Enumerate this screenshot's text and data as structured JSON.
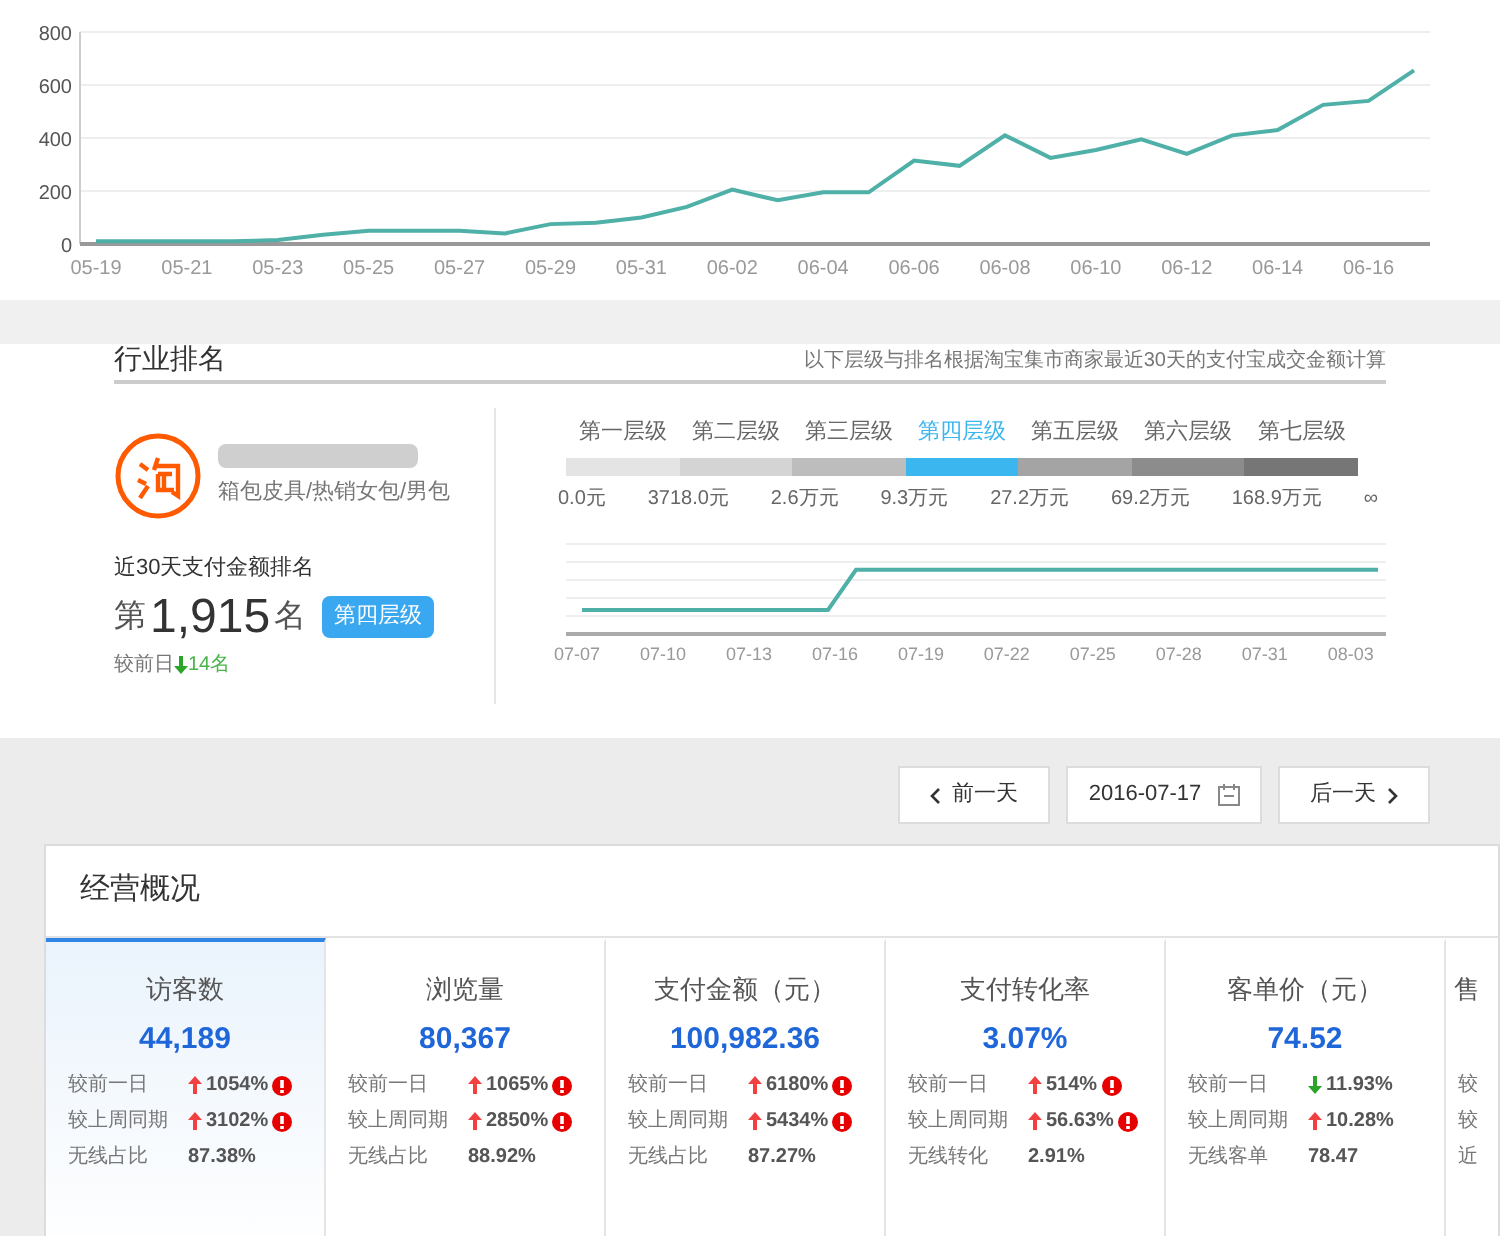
{
  "trend_chart": {
    "chart_data": {
      "type": "line",
      "grid": true,
      "categories": [
        "05-19",
        null,
        "05-21",
        null,
        "05-23",
        null,
        "05-25",
        null,
        "05-27",
        null,
        "05-29",
        null,
        "05-31",
        null,
        "06-02",
        null,
        "06-04",
        null,
        "06-06",
        null,
        "06-08",
        null,
        "06-10",
        null,
        "06-12",
        null,
        "06-14",
        null,
        "06-16",
        null
      ],
      "series": [
        {
          "color": "#4fb0a8",
          "values": [
            10,
            10,
            10,
            10,
            15,
            35,
            50,
            50,
            50,
            40,
            75,
            80,
            100,
            140,
            205,
            165,
            195,
            195,
            315,
            295,
            410,
            325,
            355,
            395,
            340,
            410,
            430,
            525,
            540,
            655
          ]
        }
      ],
      "ylim": [
        0,
        800
      ],
      "yticks": [
        0,
        200,
        400,
        600,
        800
      ]
    }
  },
  "industry_rank": {
    "title": "行业排名",
    "note": "以下层级与排名根据淘宝集市商家最近30天的支付宝成交金额计算",
    "shop": {
      "category": "箱包皮具/热销女包/男包"
    },
    "rank_label": "近30天支付金额排名",
    "rank_prefix": "第",
    "rank": "1,915",
    "rank_suffix": "名",
    "tier_badge": "第四层级",
    "change_label": "较前日",
    "change": "14名",
    "change_rising": false,
    "tiers": [
      {
        "label": "第一层级",
        "selected": false,
        "color": "#e4e4e4"
      },
      {
        "label": "第二层级",
        "selected": false,
        "color": "#d4d4d4"
      },
      {
        "label": "第三层级",
        "selected": false,
        "color": "#bdbdbd"
      },
      {
        "label": "第四层级",
        "selected": true,
        "color": "#3bb6ee"
      },
      {
        "label": "第五层级",
        "selected": false,
        "color": "#a4a4a4"
      },
      {
        "label": "第六层级",
        "selected": false,
        "color": "#8c8c8c"
      },
      {
        "label": "第七层级",
        "selected": false,
        "color": "#767676"
      }
    ],
    "thresholds": [
      "0.0元",
      "3718.0元",
      "2.6万元",
      "9.3万元",
      "27.2万元",
      "69.2万元",
      "168.9万元",
      "∞"
    ],
    "rank_axis": [
      "07-07",
      "07-10",
      "07-13",
      "07-16",
      "07-19",
      "07-22",
      "07-25",
      "07-28",
      "07-31",
      "08-03"
    ]
  },
  "date_nav": {
    "prev": "前一天",
    "date": "2016-07-17",
    "next": "后一天"
  },
  "overview": {
    "title": "经营概况",
    "metrics": [
      {
        "title": "访客数",
        "value": "44,189",
        "selected": true,
        "rows": [
          {
            "label": "较前一日",
            "rising": true,
            "value": "1054%",
            "alert": true
          },
          {
            "label": "较上周同期",
            "rising": true,
            "value": "3102%",
            "alert": true
          },
          {
            "label": "无线占比",
            "value": "87.38%"
          }
        ]
      },
      {
        "title": "浏览量",
        "value": "80,367",
        "selected": false,
        "rows": [
          {
            "label": "较前一日",
            "rising": true,
            "value": "1065%",
            "alert": true
          },
          {
            "label": "较上周同期",
            "rising": true,
            "value": "2850%",
            "alert": true
          },
          {
            "label": "无线占比",
            "value": "88.92%"
          }
        ]
      },
      {
        "title": "支付金额（元）",
        "value": "100,982.36",
        "selected": false,
        "rows": [
          {
            "label": "较前一日",
            "rising": true,
            "value": "6180%",
            "alert": true
          },
          {
            "label": "较上周同期",
            "rising": true,
            "value": "5434%",
            "alert": true
          },
          {
            "label": "无线占比",
            "value": "87.27%"
          }
        ]
      },
      {
        "title": "支付转化率",
        "value": "3.07%",
        "selected": false,
        "rows": [
          {
            "label": "较前一日",
            "rising": true,
            "value": "514%",
            "alert": true
          },
          {
            "label": "较上周同期",
            "rising": true,
            "value": "56.63%",
            "alert": true
          },
          {
            "label": "无线转化",
            "value": "2.91%"
          }
        ]
      },
      {
        "title": "客单价（元）",
        "value": "74.52",
        "selected": false,
        "rows": [
          {
            "label": "较前一日",
            "rising": false,
            "value": "11.93%",
            "alert": false
          },
          {
            "label": "较上周同期",
            "rising": true,
            "value": "10.28%",
            "alert": false
          },
          {
            "label": "无线客单",
            "value": "78.47"
          }
        ]
      },
      {
        "title": "售",
        "selected": false,
        "rows": [
          {
            "label": "较"
          },
          {
            "label": "较"
          },
          {
            "label": "近"
          }
        ]
      }
    ]
  }
}
